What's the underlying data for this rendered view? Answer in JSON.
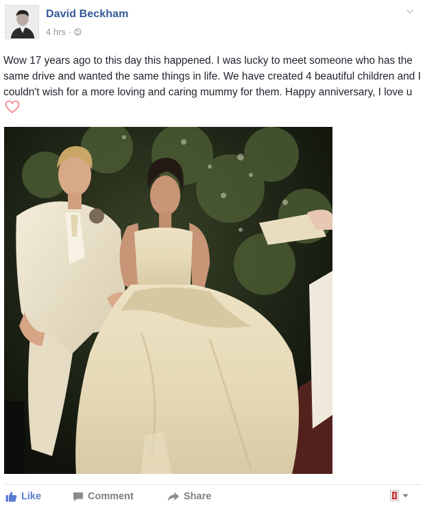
{
  "post": {
    "author": "David Beckham",
    "time": "4 hrs",
    "separator": "·",
    "text": "Wow 17 years ago to this day this happened. I was lucky to meet someone who has the same drive and wanted the same things in life. We have created 4 beautiful children and I couldn't wish for a more loving and caring mummy for them. Happy anniversary, I love u",
    "emoji": "heart-icon",
    "privacy_icon": "globe-icon"
  },
  "actions": {
    "like_label": "Like",
    "comment_label": "Comment",
    "share_label": "Share"
  },
  "colors": {
    "author_link": "#365899",
    "meta_gray": "#90949c",
    "like_blue": "#5b7bd5",
    "action_gray": "#7f7f7f",
    "heart_pink": "#f0777e"
  }
}
